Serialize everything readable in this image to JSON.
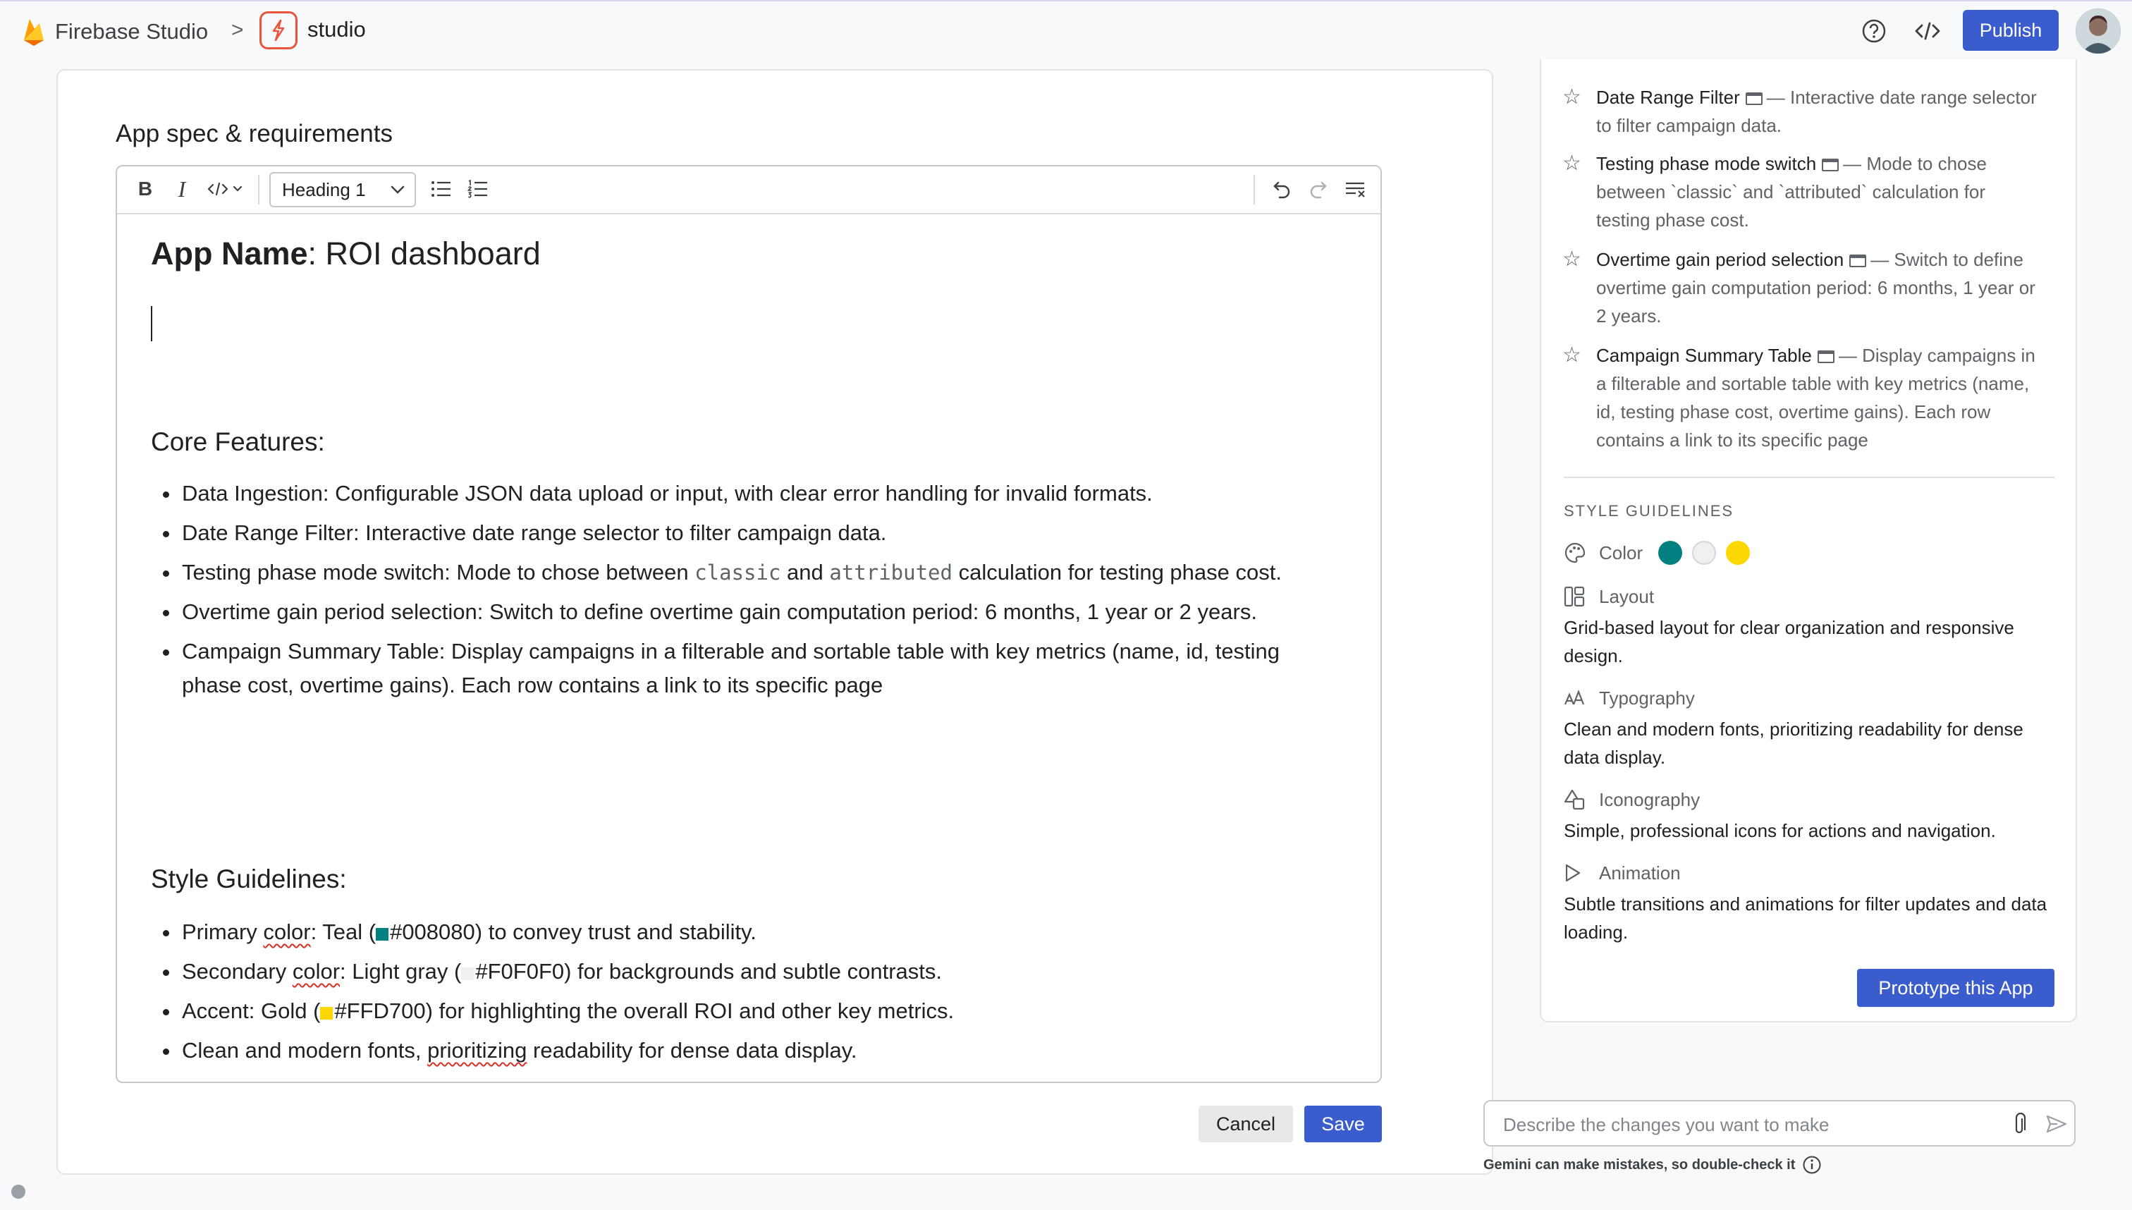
{
  "header": {
    "brand": "Firebase Studio",
    "breadcrumb_separator": ">",
    "project_name": "studio",
    "publish_label": "Publish"
  },
  "editor": {
    "section_title": "App spec & requirements",
    "toolbar": {
      "bold": "B",
      "italic": "I",
      "heading_value": "Heading 1"
    },
    "doc": {
      "app_name_label": "App Name",
      "app_name_rest": ": ROI dashboard",
      "core_title": "Core Features:",
      "core_items": [
        "Data Ingestion: Configurable JSON data upload or input, with clear error handling for invalid formats.",
        "Date Range Filter: Interactive date range selector to filter campaign data."
      ],
      "testing_item": {
        "pre": "Testing phase mode switch: Mode to chose between ",
        "code1": "classic",
        "mid": " and ",
        "code2": "attributed",
        "post": " calculation for testing phase cost."
      },
      "core_items_2": [
        "Overtime gain period selection: Switch to define overtime gain computation period: 6 months, 1 year or 2 years.",
        "Campaign Summary Table: Display campaigns in a filterable and sortable table with key metrics (name, id, testing phase cost, overtime gains). Each row contains a link to its specific page"
      ],
      "style_title": "Style Guidelines:",
      "style_items": [
        {
          "pre": "Primary ",
          "squiggle": "color",
          "mid": ": Teal (",
          "swatch": "#008080",
          "hex": "#008080",
          "post": ") to convey trust and stability."
        },
        {
          "pre": "Secondary ",
          "squiggle": "color",
          "mid": ": Light gray (",
          "swatch": "#F0F0F0",
          "hex": "#F0F0F0",
          "post": ") for backgrounds and subtle contrasts."
        },
        {
          "pre": "Accent: Gold (",
          "squiggle": "",
          "mid": "",
          "swatch": "#FFD700",
          "hex": "#FFD700",
          "post": ") for highlighting the overall ROI and other key metrics."
        }
      ],
      "fonts_item": {
        "pre": "Clean and modern fonts, ",
        "squiggle": "prioritizing",
        "post": " readability for dense data display."
      }
    },
    "cancel_label": "Cancel",
    "save_label": "Save"
  },
  "panel": {
    "features": [
      {
        "name": "Date Range Filter",
        "desc": "— Interactive date range selector to filter campaign data."
      },
      {
        "name": "Testing phase mode switch",
        "desc": "— Mode to chose between `classic` and `attributed` calculation for testing phase cost."
      },
      {
        "name": "Overtime gain period selection",
        "desc": "— Switch to define overtime gain computation period: 6 months, 1 year or 2 years."
      },
      {
        "name": "Campaign Summary Table",
        "desc": "— Display campaigns in a filterable and sortable table with key metrics (name, id, testing phase cost, overtime gains). Each row contains a link to its specific page"
      }
    ],
    "style_header": "STYLE GUIDELINES",
    "color_label": "Color",
    "colors": [
      "#008080",
      "#F0F0F0",
      "#FFD700"
    ],
    "layout_label": "Layout",
    "layout_desc": "Grid-based layout for clear organization and responsive design.",
    "typography_label": "Typography",
    "typography_desc": "Clean and modern fonts, prioritizing readability for dense data display.",
    "iconography_label": "Iconography",
    "iconography_desc": "Simple, professional icons for actions and navigation.",
    "animation_label": "Animation",
    "animation_desc": "Subtle transitions and animations for filter updates and data loading.",
    "prototype_label": "Prototype this App"
  },
  "chat": {
    "placeholder": "Describe the changes you want to make",
    "disclaimer": "Gemini can make mistakes, so double-check it"
  }
}
